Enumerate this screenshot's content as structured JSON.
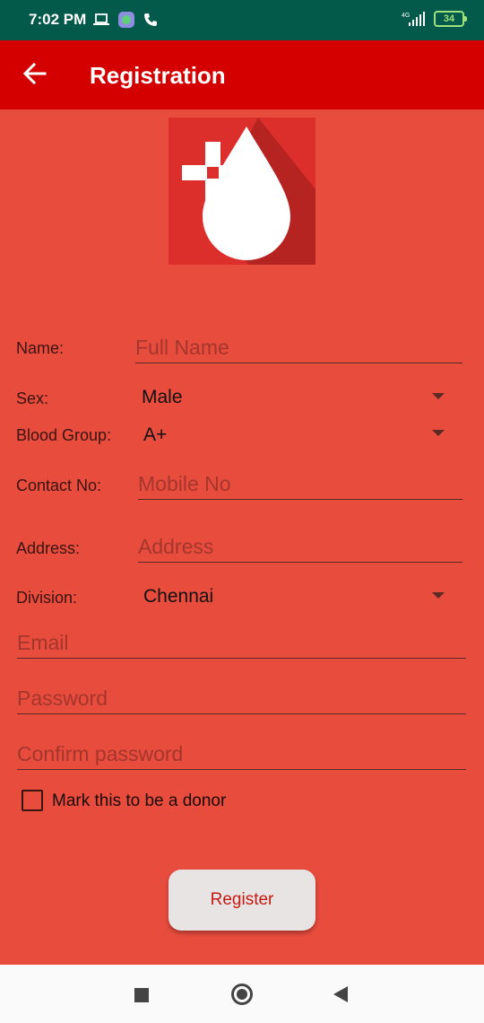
{
  "status_bar": {
    "time": "7:02 PM",
    "network": "4G",
    "battery": "34"
  },
  "app_bar": {
    "title": "Registration"
  },
  "form": {
    "name": {
      "label": "Name:",
      "placeholder": "Full Name"
    },
    "sex": {
      "label": "Sex:",
      "value": "Male"
    },
    "blood_group": {
      "label": "Blood Group:",
      "value": "A+"
    },
    "contact": {
      "label": "Contact No:",
      "placeholder": "Mobile No"
    },
    "address": {
      "label": "Address:",
      "placeholder": "Address"
    },
    "division": {
      "label": "Division:",
      "value": "Chennai"
    },
    "email": {
      "placeholder": "Email"
    },
    "password": {
      "placeholder": "Password"
    },
    "confirm_password": {
      "placeholder": "Confirm password"
    },
    "donor_checkbox": {
      "label": "Mark this to be a donor",
      "checked": false
    },
    "register_button": "Register"
  },
  "colors": {
    "status_bar": "#03594a",
    "app_bar": "#d40000",
    "background": "#e84c3d",
    "button_text": "#c41a14"
  }
}
